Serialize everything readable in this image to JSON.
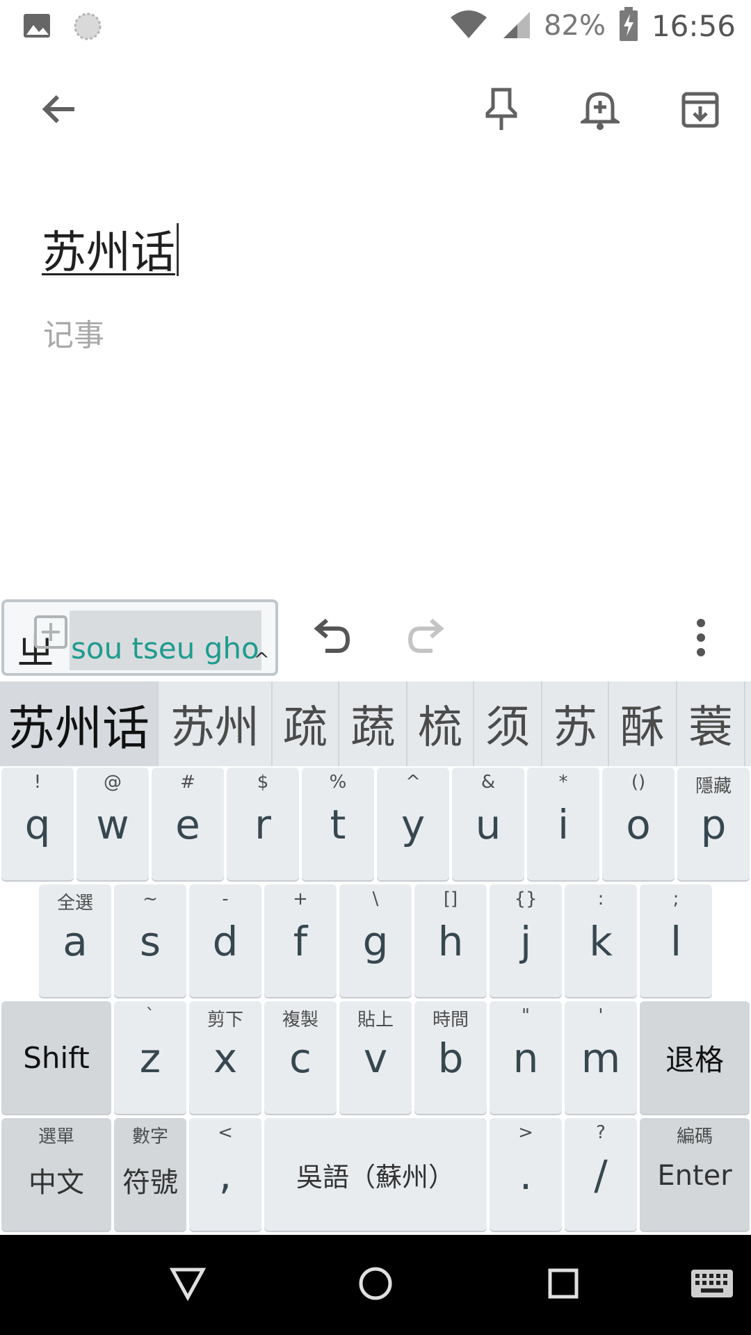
{
  "status_bar": {
    "battery_percent": "82%",
    "time": "16:56",
    "icons": [
      "image-icon",
      "sync-icon",
      "wifi-icon",
      "signal-icon",
      "battery-charging-icon"
    ]
  },
  "toolbar": {
    "icons": [
      "back-arrow-icon",
      "pin-icon",
      "reminder-bell-icon",
      "archive-icon"
    ]
  },
  "note": {
    "title": "苏州话",
    "body_placeholder": "记事"
  },
  "ime": {
    "radical": "ㄓ",
    "composing": "sou tseu gho",
    "expand": "^",
    "candidates": [
      "苏州话",
      "苏州",
      "疏",
      "蔬",
      "梳",
      "须",
      "苏",
      "酥",
      "蓑"
    ],
    "rows": [
      [
        {
          "hint": "!",
          "main": "q"
        },
        {
          "hint": "@",
          "main": "w"
        },
        {
          "hint": "#",
          "main": "e"
        },
        {
          "hint": "$",
          "main": "r"
        },
        {
          "hint": "%",
          "main": "t"
        },
        {
          "hint": "^",
          "main": "y"
        },
        {
          "hint": "&",
          "main": "u"
        },
        {
          "hint": "*",
          "main": "i"
        },
        {
          "hint": "()",
          "main": "o"
        },
        {
          "hint": "隱藏",
          "main": "p"
        }
      ],
      [
        {
          "hint": "全選",
          "main": "a"
        },
        {
          "hint": "~",
          "main": "s"
        },
        {
          "hint": "-",
          "main": "d"
        },
        {
          "hint": "+",
          "main": "f"
        },
        {
          "hint": "\\",
          "main": "g"
        },
        {
          "hint": "[]",
          "main": "h"
        },
        {
          "hint": "{}",
          "main": "j"
        },
        {
          "hint": ":",
          "main": "k"
        },
        {
          "hint": ";",
          "main": "l"
        }
      ],
      [
        {
          "hint": "`",
          "main": "z"
        },
        {
          "hint": "剪下",
          "main": "x"
        },
        {
          "hint": "複製",
          "main": "c"
        },
        {
          "hint": "貼上",
          "main": "v"
        },
        {
          "hint": "時間",
          "main": "b"
        },
        {
          "hint": "\"",
          "main": "n"
        },
        {
          "hint": "'",
          "main": "m"
        }
      ]
    ],
    "shift_label": "Shift",
    "backspace_label": "退格",
    "bottom": {
      "lang_hint": "選單",
      "lang_label": "中文",
      "sym_hint": "數字",
      "sym_label": "符號",
      "comma_hint": "<",
      "comma_label": ",",
      "space_label": "吳語（蘇州）",
      "period_hint": ">",
      "period_label": ".",
      "slash_hint": "?",
      "slash_label": "/",
      "enter_hint": "編碼",
      "enter_label": "Enter"
    }
  },
  "nav_bar": {
    "icons": [
      "back-triangle-icon",
      "home-circle-icon",
      "recents-square-icon",
      "keyboard-icon"
    ]
  }
}
